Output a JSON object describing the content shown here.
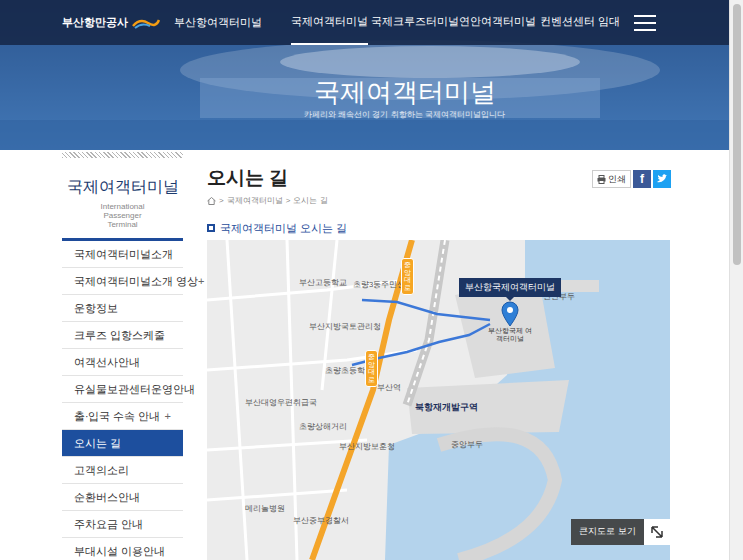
{
  "header": {
    "brand": "부산항만공사",
    "site": "부산항여객터미널",
    "nav": [
      {
        "label": "국제여객터미널",
        "selected": true
      },
      {
        "label": "국제크루즈터미널",
        "selected": false
      },
      {
        "label": "연안여객터미널",
        "selected": false
      },
      {
        "label": "컨벤션센터 임대",
        "selected": false
      }
    ]
  },
  "hero": {
    "title": "국제여객터미널",
    "subtitle": "카페리와 쾌속선이 경기 취항하는 국제여객터미널입니다"
  },
  "sidebar": {
    "title": "국제여객터미널",
    "subtitle": [
      "International",
      "Passenger",
      "Terminal"
    ],
    "items": [
      {
        "label": "국제여객터미널소개",
        "toggle": "",
        "selected": false
      },
      {
        "label": "국제여객터미널소개 영상",
        "toggle": "+",
        "selected": false
      },
      {
        "label": "운항정보",
        "toggle": "",
        "selected": false
      },
      {
        "label": "크루즈 입항스케줄",
        "toggle": "",
        "selected": false
      },
      {
        "label": "여객선사안내",
        "toggle": "",
        "selected": false
      },
      {
        "label": "유실물보관센터운영안내",
        "toggle": "",
        "selected": false
      },
      {
        "label": "출·입국 수속 안내",
        "toggle": "+",
        "selected": false
      },
      {
        "label": "오시는 길",
        "toggle": "",
        "selected": true
      },
      {
        "label": "고객의소리",
        "toggle": "",
        "selected": false
      },
      {
        "label": "순환버스안내",
        "toggle": "",
        "selected": false
      },
      {
        "label": "주차요금 안내",
        "toggle": "",
        "selected": false
      },
      {
        "label": "부대시설 이용안내",
        "toggle": "",
        "selected": false
      }
    ]
  },
  "content": {
    "title": "오시는 길",
    "breadcrumb": {
      "separator": ">",
      "items": [
        "국제여객터미널",
        "오시는 길"
      ]
    },
    "print": "인쇄",
    "facebook": "f",
    "section_title": "국제여객터미널 오시는 길"
  },
  "map": {
    "marker_label": "부산항국제여객터미널",
    "marker_sublabel": "부산항국제 여객터미널",
    "labels": [
      "부산고등학교",
      "초량3동주민센터",
      "부산지방국토관리청",
      "초량초등학교",
      "부산역",
      "초량상해거리",
      "북항재개발구역",
      "부산대영우편취급국",
      "부산지방보훈청",
      "메리놀병원",
      "부산중부경찰서",
      "중앙부두",
      "연안부두"
    ],
    "road_shields": [
      "중앙대로",
      "중앙대로"
    ],
    "button": "큰지도로 보기"
  },
  "scrollbar": {
    "level": 0.47
  }
}
